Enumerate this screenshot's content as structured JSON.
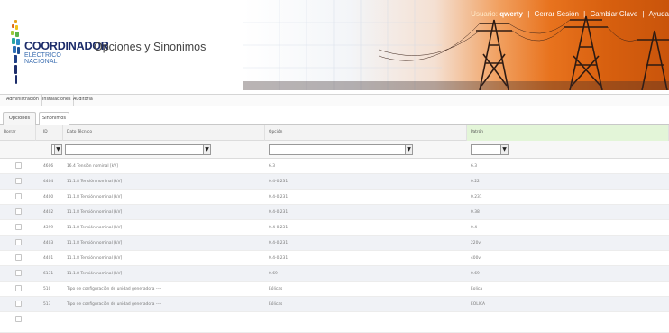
{
  "logo": {
    "line1": "COORDINADOR",
    "line2": "ELÉCTRICO NACIONAL"
  },
  "app_title": "Opciones y Sinonimos",
  "topnav": {
    "user_label": "Usuario:",
    "user_name": "qwerty",
    "logout": "Cerrar Sesión",
    "change_password": "Cambiar Clave",
    "help": "Ayuda"
  },
  "menu": {
    "items": [
      "Administración",
      "Instalaciones",
      "Auditoria"
    ]
  },
  "tabs": [
    {
      "label": "Opciones",
      "active": false
    },
    {
      "label": "Sinonimos",
      "active": true
    }
  ],
  "grid": {
    "headers": {
      "borrar": "Borrar",
      "id": "ID",
      "dato": "Dato Técnico",
      "opcion": "Opción",
      "patron": "Patrón"
    },
    "filter_icon": "filter-icon",
    "rows": [
      {
        "id": "4606",
        "dato": "16.4 Tensión nominal [kV]",
        "opcion": "6.3",
        "patron": "6.3"
      },
      {
        "id": "4404",
        "dato": "11.1.8 Tensión nominal [kV]",
        "opcion": "0.4-0.231",
        "patron": "0.22"
      },
      {
        "id": "4400",
        "dato": "11.1.8 Tensión nominal [kV]",
        "opcion": "0.4-0.231",
        "patron": "0.231"
      },
      {
        "id": "4402",
        "dato": "11.1.8 Tensión nominal [kV]",
        "opcion": "0.4-0.231",
        "patron": "0.38"
      },
      {
        "id": "4399",
        "dato": "11.1.8 Tensión nominal [kV]",
        "opcion": "0.4-0.231",
        "patron": "0.4"
      },
      {
        "id": "4403",
        "dato": "11.1.8 Tensión nominal [kV]",
        "opcion": "0.4-0.231",
        "patron": "220v"
      },
      {
        "id": "4401",
        "dato": "11.1.8 Tensión nominal [kV]",
        "opcion": "0.4-0.231",
        "patron": "400v"
      },
      {
        "id": "6131",
        "dato": "11.1.8 Tensión nominal [kV]",
        "opcion": "0.69",
        "patron": "0.69"
      },
      {
        "id": "510",
        "dato": "Tipo de configuración de unidad generadora ----",
        "opcion": "Eólicas",
        "patron": "Eolica"
      },
      {
        "id": "513",
        "dato": "Tipo de configuración de unidad generadora ----",
        "opcion": "Eólicas",
        "patron": "EOLICA"
      }
    ]
  },
  "colors": {
    "brand_navy": "#1c2c6a",
    "brand_blue": "#3a6db0",
    "patron_header": "#e3f5d8",
    "row_alt": "#f0f2f6"
  }
}
